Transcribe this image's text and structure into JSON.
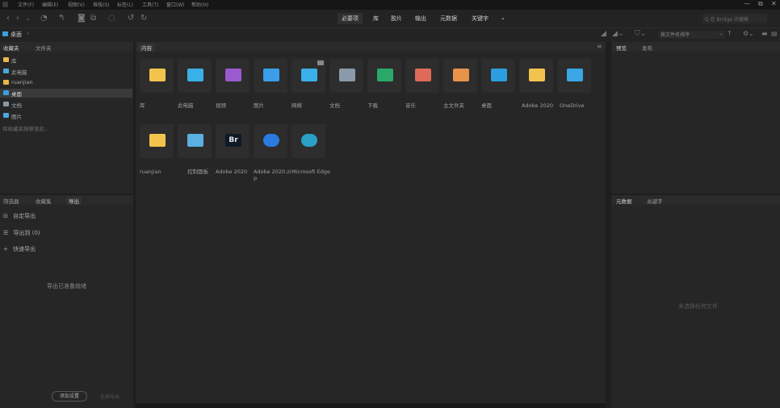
{
  "menubar": {
    "items": [
      "文件(F)",
      "编辑(E)",
      "视图(V)",
      "堆栈(S)",
      "标签(L)",
      "工具(T)",
      "窗口(W)",
      "帮助(H)"
    ],
    "window_controls": [
      "—",
      "⧉",
      "✕"
    ]
  },
  "toolbar": {
    "workspaces": [
      "必要项",
      "库",
      "胶片",
      "输出",
      "元数据",
      "关键字"
    ],
    "more_glyph": "⌄",
    "search_placeholder": "Q 在 Bridge 中搜索",
    "sort_label": "按文件名排序"
  },
  "path": {
    "current": "桌面",
    "separator": "›"
  },
  "left_top": {
    "tabs": [
      "收藏夹",
      "文件夹"
    ],
    "items": [
      {
        "label": "库",
        "color": "#e8b84a"
      },
      {
        "label": "此电脑",
        "color": "#4aa8e0"
      },
      {
        "label": "ruanjian",
        "color": "#e8b84a"
      },
      {
        "label": "桌面",
        "color": "#3aa0e0"
      },
      {
        "label": "文档",
        "color": "#8a9aa8"
      },
      {
        "label": "图片",
        "color": "#4aa8e0"
      }
    ],
    "drag_hint": "将收藏夹拖移至此..."
  },
  "left_bottom": {
    "tabs": [
      "筛选器",
      "收藏集",
      "导出"
    ],
    "rows": [
      "自定导出",
      "导出到 (0)",
      "快速导出"
    ],
    "empty_text": "导出已准备就绪",
    "buttons": [
      "添加设置",
      "全部导出"
    ]
  },
  "content": {
    "tab": "内容",
    "menu_glyph": "≡",
    "items": [
      {
        "label": "库",
        "color": "#f2c44e"
      },
      {
        "label": "此电脑",
        "color": "#3ab0e8"
      },
      {
        "label": "视频",
        "color": "#9a5ad0"
      },
      {
        "label": "图片",
        "color": "#3a9ee8"
      },
      {
        "label": "网络",
        "color": "#3ab0e8"
      },
      {
        "label": "文档",
        "color": "#8a9aaa"
      },
      {
        "label": "下载",
        "color": "#2aa86a"
      },
      {
        "label": "音乐",
        "color": "#e06a5a"
      },
      {
        "label": "主文件夹",
        "color": "#e8924a"
      },
      {
        "label": "桌面",
        "color": "#2a9ee0"
      },
      {
        "label": "Adobe 2020",
        "color": "#f2c44e"
      },
      {
        "label": "OneDrive",
        "color": "#3aa6e6"
      },
      {
        "label": "ruanjian",
        "color": "#f2c44e"
      },
      {
        "label": "控制面板",
        "color": "#5ab0e0"
      },
      {
        "label": "Adobe 2020",
        "color": "#0e1a26",
        "badge": "Br"
      },
      {
        "label": "Adobe 2020.zip",
        "color": "#2a7ae0"
      },
      {
        "label": "Microsoft Edge",
        "color": "#2aa0c8"
      }
    ]
  },
  "right_top": {
    "tabs": [
      "预览",
      "发布"
    ]
  },
  "right_bottom": {
    "tabs": [
      "元数据",
      "关键字"
    ],
    "empty_text": "未选择任何文件"
  }
}
